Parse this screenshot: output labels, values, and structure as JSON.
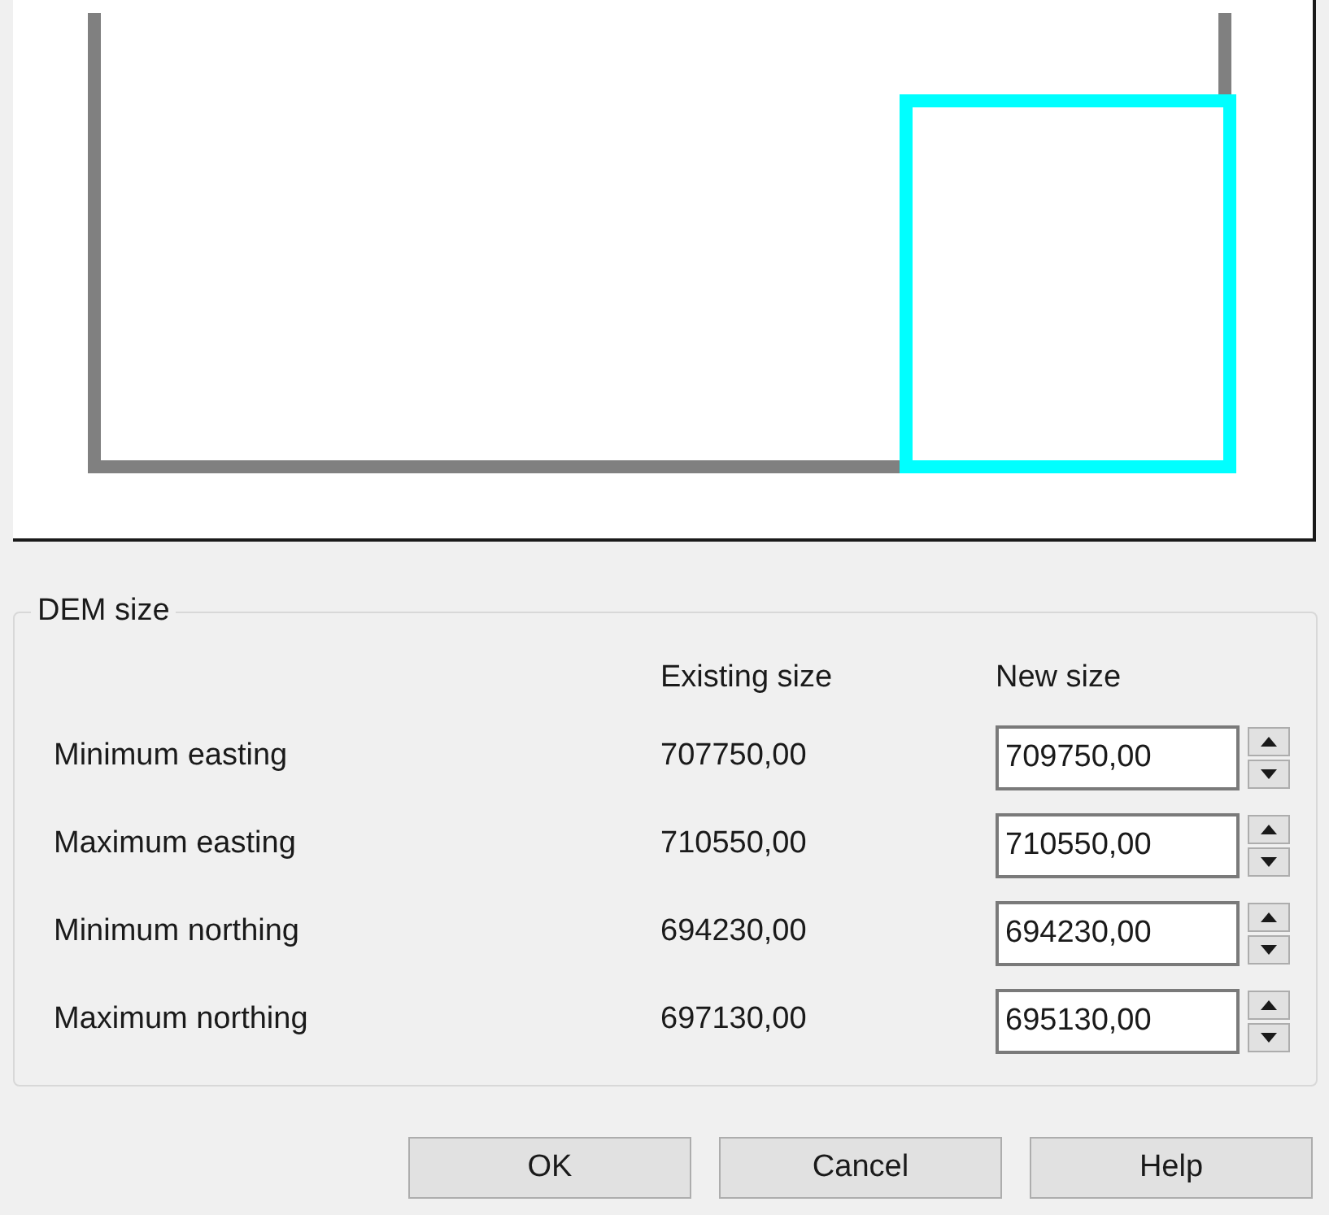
{
  "group": {
    "title": "DEM size",
    "columns": [
      "Existing size",
      "New size"
    ],
    "rows": [
      {
        "label": "Minimum easting",
        "existing": "707750,00",
        "new": "709750,00"
      },
      {
        "label": "Maximum easting",
        "existing": "710550,00",
        "new": "710550,00"
      },
      {
        "label": "Minimum northing",
        "existing": "694230,00",
        "new": "694230,00"
      },
      {
        "label": "Maximum northing",
        "existing": "697130,00",
        "new": "695130,00"
      }
    ]
  },
  "buttons": [
    "OK",
    "Cancel",
    "Help"
  ]
}
